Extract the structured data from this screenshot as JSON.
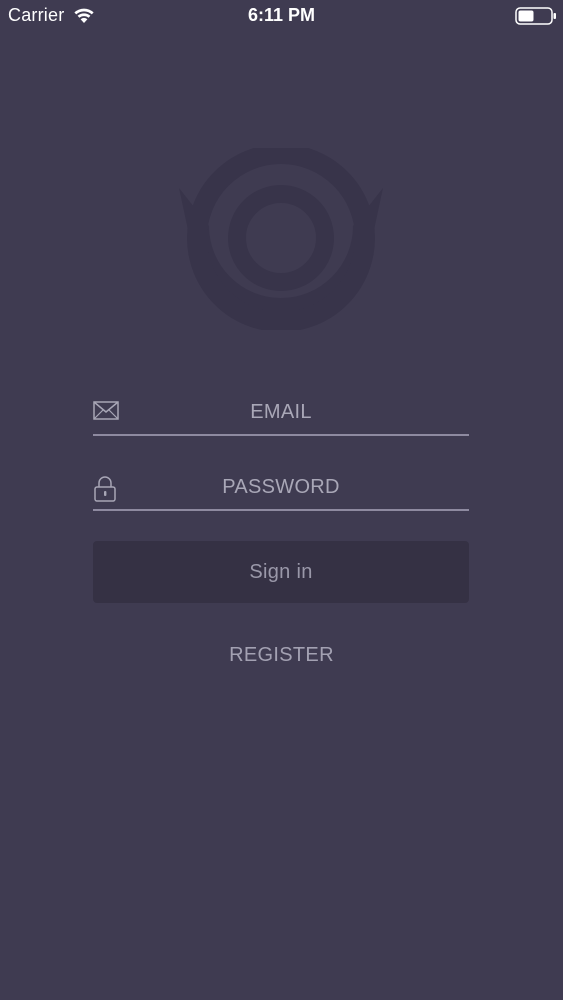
{
  "status_bar": {
    "carrier": "Carrier",
    "time": "6:11 PM",
    "icons": [
      "wifi-icon",
      "battery-icon"
    ]
  },
  "logo": {
    "icon": "target-logo-icon"
  },
  "login_form": {
    "email": {
      "icon": "envelope-icon",
      "placeholder": "EMAIL",
      "value": ""
    },
    "password": {
      "icon": "lock-icon",
      "placeholder": "PASSWORD",
      "value": ""
    },
    "sign_in_label": "Sign in",
    "register_label": "REGISTER"
  },
  "colors": {
    "background": "#3f3b51",
    "button": "#353144",
    "underline": "#8e8aa0",
    "text_muted": "#a8a6b6",
    "logo": "#38344a"
  }
}
